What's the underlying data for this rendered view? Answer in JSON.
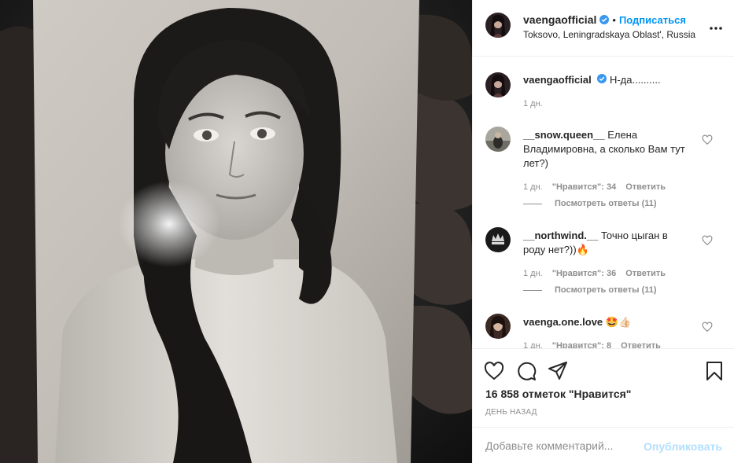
{
  "post": {
    "username": "vaengaofficial",
    "dot": "•",
    "follow_label": "Подписаться",
    "location": "Toksovo, Leningradskaya Oblast', Russia",
    "caption_text": "Н-да..........",
    "caption_time": "1 дн."
  },
  "comments": [
    {
      "username": "__snow.queen__",
      "text": "Елена Владимировна, а сколько Вам тут лет?)",
      "time": "1 дн.",
      "likes": "\"Нравится\": 34",
      "reply_label": "Ответить",
      "view_replies": "Посмотреть ответы (11)"
    },
    {
      "username": "__northwind.__",
      "text": "Точно цыган в роду нет?))🔥",
      "time": "1 дн.",
      "likes": "\"Нравится\": 36",
      "reply_label": "Ответить",
      "view_replies": "Посмотреть ответы (11)"
    },
    {
      "username": "vaenga.one.love",
      "text": "🤩👍🏻",
      "time": "1 дн.",
      "likes": "\"Нравится\": 8",
      "reply_label": "Ответить"
    }
  ],
  "actions": {
    "likes_count": "16 858 отметок \"Нравится\"",
    "time_ago": "день назад",
    "icons": [
      "heart-icon",
      "comment-icon",
      "share-icon",
      "bookmark-icon"
    ]
  },
  "add_comment": {
    "placeholder": "Добавьте комментарий...",
    "publish_label": "Опубликовать"
  },
  "colors": {
    "accent": "#0095f6",
    "publish_disabled": "#b2dffc",
    "meta_gray": "#8e8e8e",
    "text": "#262626"
  }
}
